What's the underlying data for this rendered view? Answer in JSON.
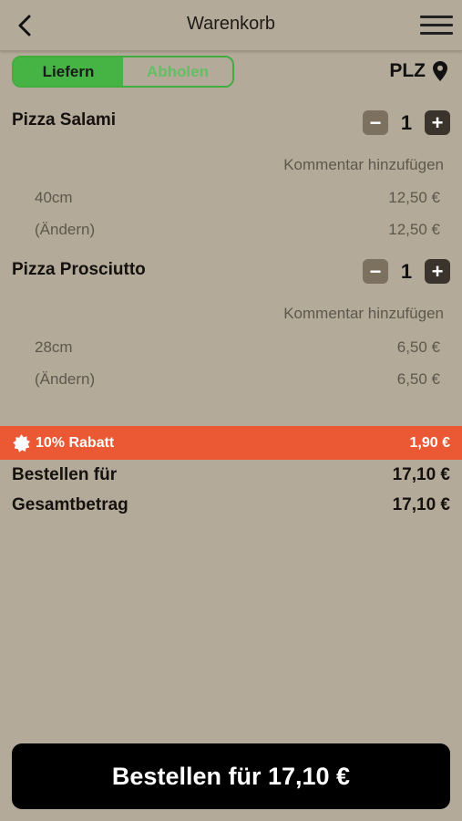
{
  "header": {
    "title": "Warenkorb",
    "back_icon": "chevron-left-icon",
    "menu_icon": "hamburger-menu-icon"
  },
  "delivery_toggle": {
    "options": [
      "Liefern",
      "Abholen"
    ],
    "selected": "Liefern"
  },
  "location": {
    "label": "PLZ",
    "icon": "map-pin-icon"
  },
  "cart": {
    "items": [
      {
        "name": "Pizza Salami",
        "quantity": "1",
        "comment_link": "Kommentar hinzufügen",
        "options": [
          {
            "label": "40cm",
            "price": "12,50 €"
          },
          {
            "label": "(Ändern)",
            "price": "12,50 €"
          }
        ]
      },
      {
        "name": "Pizza Prosciutto",
        "quantity": "1",
        "comment_link": "Kommentar hinzufügen",
        "options": [
          {
            "label": "28cm",
            "price": "6,50 €"
          },
          {
            "label": "(Ändern)",
            "price": "6,50 €"
          }
        ]
      }
    ]
  },
  "discount": {
    "label": "10% Rabatt",
    "value": "1,90 €",
    "icon": "discount-badge-icon"
  },
  "summary": {
    "order_for_label": "Bestellen für",
    "order_for_value": "17,10 €",
    "total_label": "Gesamtbetrag",
    "total_value": "17,10 €"
  },
  "order_button": {
    "label": "Bestellen für 17,10 €"
  },
  "colors": {
    "background": "#b4aa9a",
    "accent_green": "#45b445",
    "discount_red": "#ea5934",
    "button_black": "#000000"
  }
}
